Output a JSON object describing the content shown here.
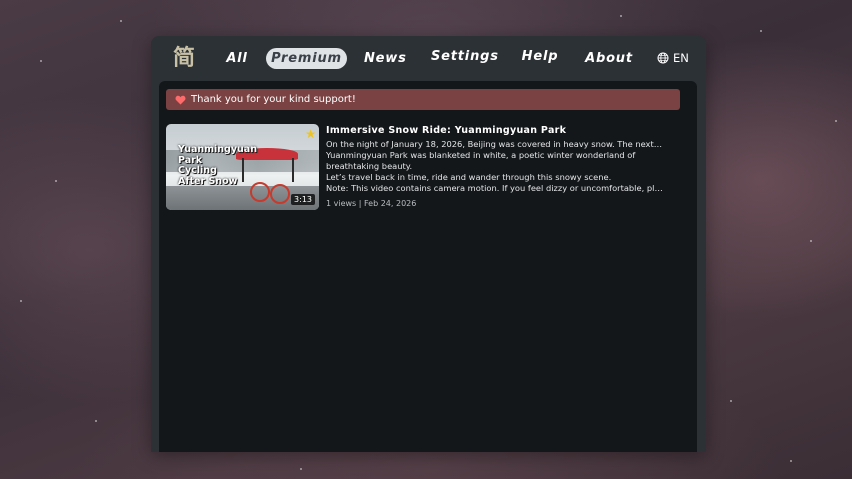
{
  "navbar": {
    "logo_glyph": "简",
    "items": [
      {
        "label": "All",
        "active": false
      },
      {
        "label": "Premium",
        "active": true
      },
      {
        "label": "News",
        "active": false
      },
      {
        "label": "Settings",
        "active": false
      },
      {
        "label": "Help",
        "active": false
      },
      {
        "label": "About",
        "active": false
      }
    ],
    "language": {
      "icon": "globe-icon",
      "label": "EN"
    }
  },
  "banner": {
    "icon": "heart-icon",
    "text": "Thank you for your kind support!",
    "color": "#7a4242"
  },
  "videos": [
    {
      "title": "Immersive Snow Ride: Yuanmingyuan Park",
      "thumbnail_text": "Yuanmingyuan\nPark\nCycling\nAfter Snow",
      "duration": "3:13",
      "starred": true,
      "description_lines": [
        "On the night of January 18, 2026, Beijing was covered in heavy snow. The next day,",
        "Yuanmingyuan Park was blanketed in white, a poetic winter wonderland of",
        "breathtaking beauty.",
        "Let’s travel back in time, ride and wander through this snowy scene.",
        "Note: This video contains camera motion. If you feel dizzy or uncomfortable, please take a break."
      ],
      "meta": "1 views | Feb 24, 2026"
    }
  ],
  "colors": {
    "window_bg": "#2c3136",
    "content_bg": "#14171a",
    "active_pill": "#dfe3e6",
    "star": "#f0c419"
  }
}
